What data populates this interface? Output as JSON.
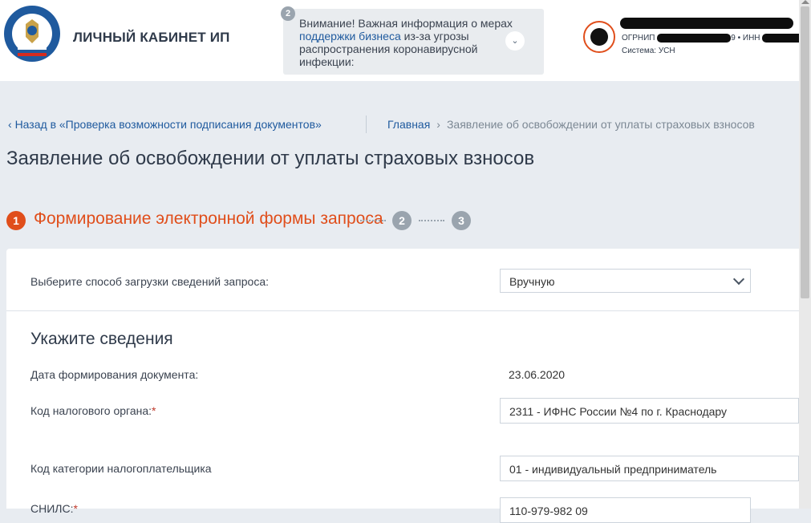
{
  "header": {
    "title": "ЛИЧНЫЙ КАБИНЕТ ИП",
    "logo_text": "ФЕДЕРАЛЬНАЯ НАЛОГОВАЯ СЛУЖБА",
    "notice": {
      "count": "2",
      "text_before": "Внимание! Важная информация о мерах ",
      "link": "поддержки бизнеса",
      "text_after": " из-за угрозы распространения коронавирусной инфекции:"
    },
    "user": {
      "ogrnip_label": "ОГРНИП",
      "ogrnip_tail": "9",
      "sep": "•",
      "inn_label": "ИНН",
      "system": "Система: УСН"
    }
  },
  "nav": {
    "back": "Назад в «Проверка возможности подписания документов»",
    "breadcrumb": {
      "home": "Главная",
      "current": "Заявление об освобождении от уплаты страховых взносов"
    }
  },
  "page_title": "Заявление об освобождении от уплаты страховых взносов",
  "stepper": {
    "steps": [
      "1",
      "2",
      "3"
    ],
    "active_label": "Формирование электронной формы запроса"
  },
  "form": {
    "upload_method_label": "Выберите способ загрузки сведений запроса:",
    "upload_method_value": "Вручную",
    "section_title": "Укажите сведения",
    "date_label": "Дата формирования документа:",
    "date_value": "23.06.2020",
    "tax_authority_label": "Код налогового органа:",
    "tax_authority_value": "2311 - ИФНС России №4 по г. Краснодару",
    "category_label": "Код категории налогоплательщика",
    "category_value": "01 - индивидуальный предприниматель",
    "snils_label": "СНИЛС:",
    "snils_value": "110-979-982 09",
    "required_mark": "*"
  },
  "colors": {
    "accent": "#e04e1b",
    "link": "#1f5a9e",
    "background": "#e8ecf1"
  }
}
